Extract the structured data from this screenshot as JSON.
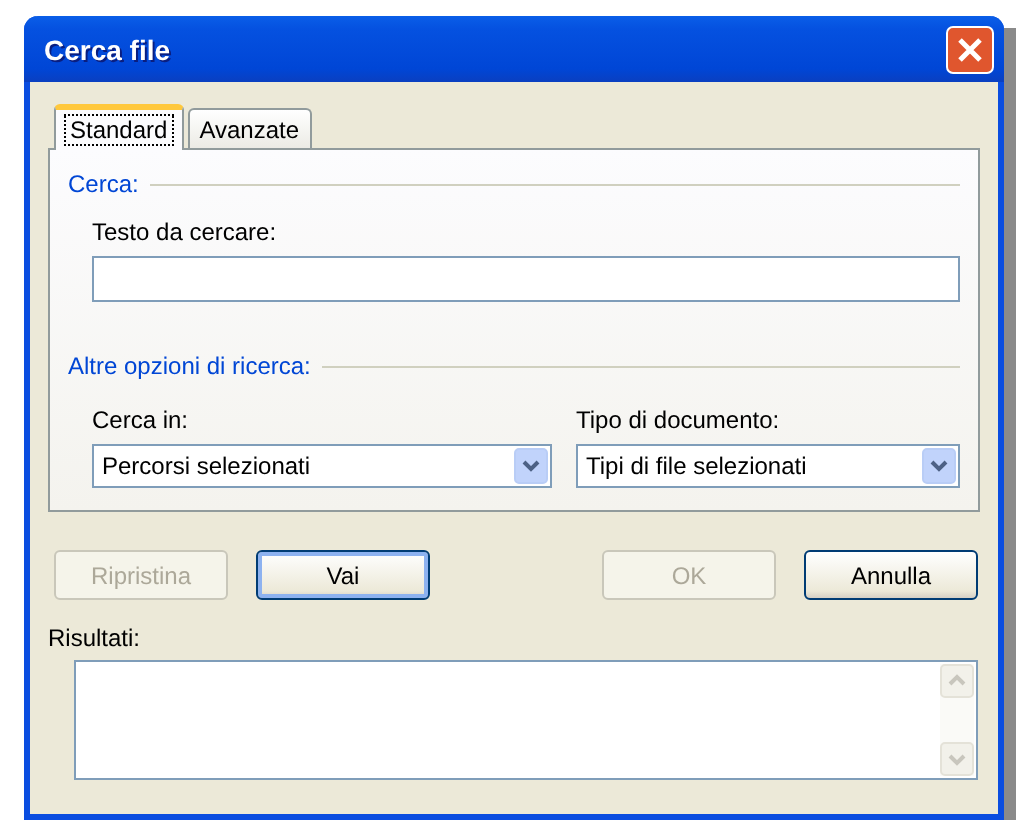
{
  "window": {
    "title": "Cerca file"
  },
  "tabs": [
    {
      "label": "Standard",
      "selected": true
    },
    {
      "label": "Avanzate",
      "selected": false
    }
  ],
  "search_section": {
    "heading": "Cerca:",
    "field_label": "Testo da cercare:"
  },
  "options_section": {
    "heading": "Altre opzioni di ricerca:",
    "dropdowns": [
      {
        "label": "Cerca in:",
        "value": "Percorsi selezionati"
      },
      {
        "label": "Tipo di documento:",
        "value": "Tipi di file selezionati"
      }
    ]
  },
  "left_buttons": [
    {
      "label": "Ripristina",
      "disabled": true,
      "default": false
    },
    {
      "label": "Vai",
      "disabled": false,
      "default": true
    }
  ],
  "right_buttons": [
    {
      "label": "OK",
      "disabled": true,
      "default": false
    },
    {
      "label": "Annulla",
      "disabled": false,
      "default": false
    }
  ],
  "results": {
    "label": "Risultati:"
  }
}
